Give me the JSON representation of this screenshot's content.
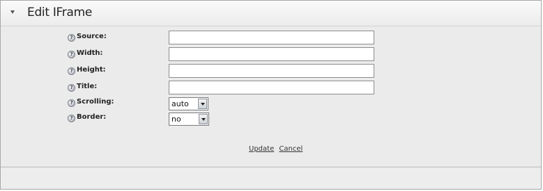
{
  "panel": {
    "title": "Edit IFrame"
  },
  "form": {
    "source_label": "Source:",
    "width_label": "Width:",
    "height_label": "Height:",
    "title_label": "Title:",
    "scrolling_label": "Scrolling:",
    "border_label": "Border:",
    "scrolling_value": "auto",
    "border_value": "no",
    "source_value": "",
    "width_value": "",
    "height_value": "",
    "title_value": ""
  },
  "actions": {
    "update_label": "Update",
    "cancel_label": "Cancel"
  },
  "icons": {
    "help": "help-icon",
    "collapse": "collapse-triangle-icon",
    "dropdown": "dropdown-arrow-icon"
  }
}
